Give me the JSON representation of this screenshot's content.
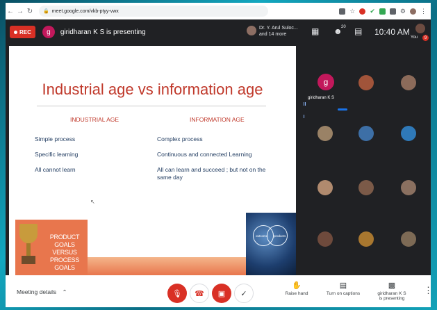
{
  "browser": {
    "url": "meet.google.com/vkb-ptyy-vwx",
    "back_icon": "arrow-left-icon",
    "forward_icon": "arrow-right-icon",
    "reload_icon": "reload-icon"
  },
  "topbar": {
    "rec_label": "REC",
    "presenter_initial": "g",
    "presenting_text": "giridharan K S is presenting",
    "pinned_name": "Dr. Y. Arul Suloc...",
    "pinned_more": "and 14 more",
    "participant_count": "20",
    "clock": "10:40 AM",
    "you_label": "You",
    "you_badge": "9"
  },
  "slide": {
    "title": "Industrial age vs information age",
    "left_heading": "INDUSTRIAL AGE",
    "right_heading": "INFORMATION AGE",
    "left_items": [
      "Simple process",
      "Specific learning",
      "All cannot learn"
    ],
    "right_items": [
      "Complex process",
      "Continuous and connected Learning",
      "All can learn and succeed ; but not on the same day"
    ],
    "goals_line1": "PRODUCT GOALS",
    "goals_line2": "VERSUS",
    "goals_line3": "PROCESS GOALS",
    "circle_left": "outcome",
    "circle_right": "products",
    "colors": {
      "title": "#c0392b",
      "body": "#1f3a5f",
      "orange": "#e8764d"
    }
  },
  "participants": {
    "presenter_name": "giridharan K S",
    "presenter_initial": "g",
    "tiles": 15
  },
  "bottombar": {
    "meeting_details": "Meeting details",
    "raise_hand": "Raise hand",
    "captions": "Turn on captions",
    "presenting_line1": "giridharan K S",
    "presenting_line2": "is presenting"
  }
}
